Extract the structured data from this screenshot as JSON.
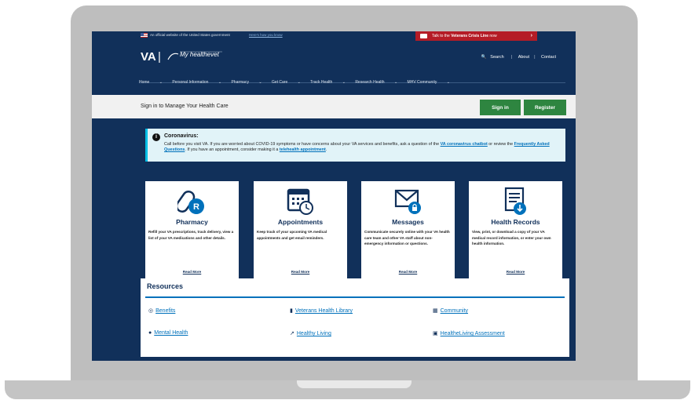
{
  "gov_banner": {
    "text": "An official website of the United States government",
    "link": "Here's how you know"
  },
  "crisis_line": {
    "prefix": "Talk to the",
    "emphasis": "Veterans Crisis Line",
    "suffix": "now",
    "arrow": "›"
  },
  "header": {
    "logo_va": "VA",
    "logo_sep": "|",
    "logo_hv": "My healthevet",
    "nav": [
      "Search",
      "About",
      "Contact"
    ]
  },
  "mainnav": [
    "Home",
    "Personal Information",
    "Pharmacy",
    "Get Care",
    "Track Health",
    "Research Health",
    "MHV Community"
  ],
  "signin": {
    "label": "Sign in to Manage Your Health Care",
    "signin_button": "Sign in",
    "register_button": "Register"
  },
  "coronavirus": {
    "title": "Coronavirus:",
    "text1": "Call before you visit VA. If you are worried about COVID-19 symptoms or have concerns about your VA services and benefits, ask a question of the",
    "link1": "VA coronavirus chatbot",
    "text2": "or review the",
    "link2": "Frequently Asked Questions",
    "text3": ". If you have an appointment, consider making it a",
    "link3": "telehealth appointment",
    "text4": "."
  },
  "cards": [
    {
      "title": "Pharmacy",
      "desc": "Refill your VA prescriptions, track delivery, view a list of your VA medications and other details.",
      "more": "Read More",
      "icon": "pill-icon"
    },
    {
      "title": "Appointments",
      "desc": "Keep track of your upcoming VA medical appointments and get email reminders.",
      "more": "Read More",
      "icon": "calendar-clock-icon"
    },
    {
      "title": "Messages",
      "desc": "Communicate securely online with your VA health care team and other VA staff about non-emergency information or questions.",
      "more": "Read More",
      "icon": "envelope-lock-icon"
    },
    {
      "title": "Health Records",
      "desc": "View, print, or download a copy of your VA medical record information, or enter your own health information.",
      "more": "Read More",
      "icon": "document-download-icon"
    }
  ],
  "resources": {
    "title": "Resources",
    "items": [
      {
        "label": "Benefits",
        "icon": "coins-icon"
      },
      {
        "label": "Veterans Health Library",
        "icon": "book-icon"
      },
      {
        "label": "Community",
        "icon": "community-icon"
      },
      {
        "label": "Mental Health",
        "icon": "brain-icon"
      },
      {
        "label": "Healthy Living",
        "icon": "runner-icon"
      },
      {
        "label": "HealtheLiving Assessment",
        "icon": "clipboard-icon"
      }
    ]
  },
  "colors": {
    "navy": "#11305a",
    "crisis_red": "#b51c26",
    "green": "#2e8540",
    "link_blue": "#0071bb",
    "alert_bg": "#e1f3f8",
    "laptop_gray": "#bebebe"
  }
}
